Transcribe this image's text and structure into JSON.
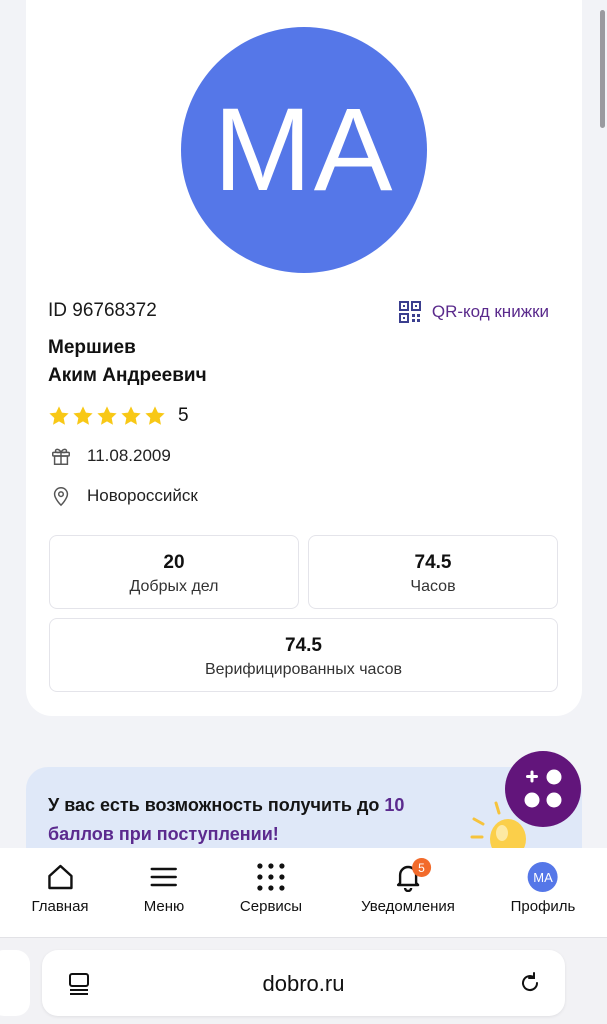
{
  "profile": {
    "initials": "МА",
    "id_text": "ID 96768372",
    "qr_label": "QR-код книжки",
    "last_name": "Мершиев",
    "first_names": "Аким Андреевич",
    "rating": 5,
    "rating_text": "5",
    "birth_date": "11.08.2009",
    "city": "Новороссийск",
    "colors": {
      "avatar": "#5577e8",
      "accent": "#5a2a8c",
      "star": "#f8c816"
    }
  },
  "stats": [
    {
      "value": "20",
      "label": "Добрых дел"
    },
    {
      "value": "74.5",
      "label": "Часов"
    },
    {
      "value": "74.5",
      "label": "Верифицированных часов"
    }
  ],
  "promo": {
    "text_before": "У вас есть возможность получить до ",
    "accent": "10 баллов при поступлении!",
    "icon": "lightbulb-icon"
  },
  "fab": {
    "icon": "plus-dots-icon",
    "color": "#62157b"
  },
  "nav": {
    "items": [
      {
        "label": "Главная",
        "icon": "home-icon"
      },
      {
        "label": "Меню",
        "icon": "menu-icon"
      },
      {
        "label": "Сервисы",
        "icon": "grid-dots-icon"
      },
      {
        "label": "Уведомления",
        "icon": "bell-icon",
        "badge": "5"
      },
      {
        "label": "Профиль",
        "icon": "avatar",
        "initials": "МА"
      }
    ]
  },
  "browser": {
    "url": "dobro.ru",
    "tab_icon": "tabs-icon",
    "reload_icon": "reload-icon"
  }
}
